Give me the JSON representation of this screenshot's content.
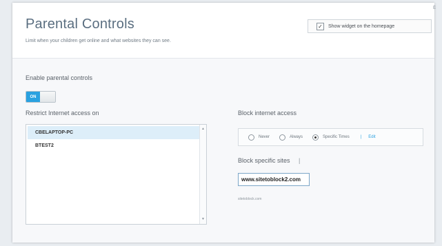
{
  "header": {
    "title": "Parental Controls",
    "subtitle": "Limit when your children get online and what websites they can see.",
    "corner_mark": "ɛ",
    "widget_checkbox": {
      "checked": true,
      "mark": "✓",
      "label": "Show widget on the homepage"
    }
  },
  "enable": {
    "label": "Enable parental controls",
    "toggle_label": "ON",
    "state": "on"
  },
  "restrict": {
    "label": "Restrict Internet access on",
    "devices": [
      "CBELAPTOP-PC",
      "BTEST2"
    ],
    "selected": "CBELAPTOP-PC",
    "scroll_up": "▲",
    "scroll_down": "▼"
  },
  "block_access": {
    "label": "Block internet access",
    "options": [
      "Never",
      "Always",
      "Specific Times"
    ],
    "selected": "Specific Times",
    "pipe": "|",
    "edit_label": "Edit"
  },
  "block_sites": {
    "label": "Block specific sites",
    "pipe": "|",
    "input_value": "www.sitetoblock2.com",
    "entries": [
      "sitetoblock.com"
    ]
  },
  "colors": {
    "accent": "#2aa1e0",
    "title": "#5a6e80"
  }
}
